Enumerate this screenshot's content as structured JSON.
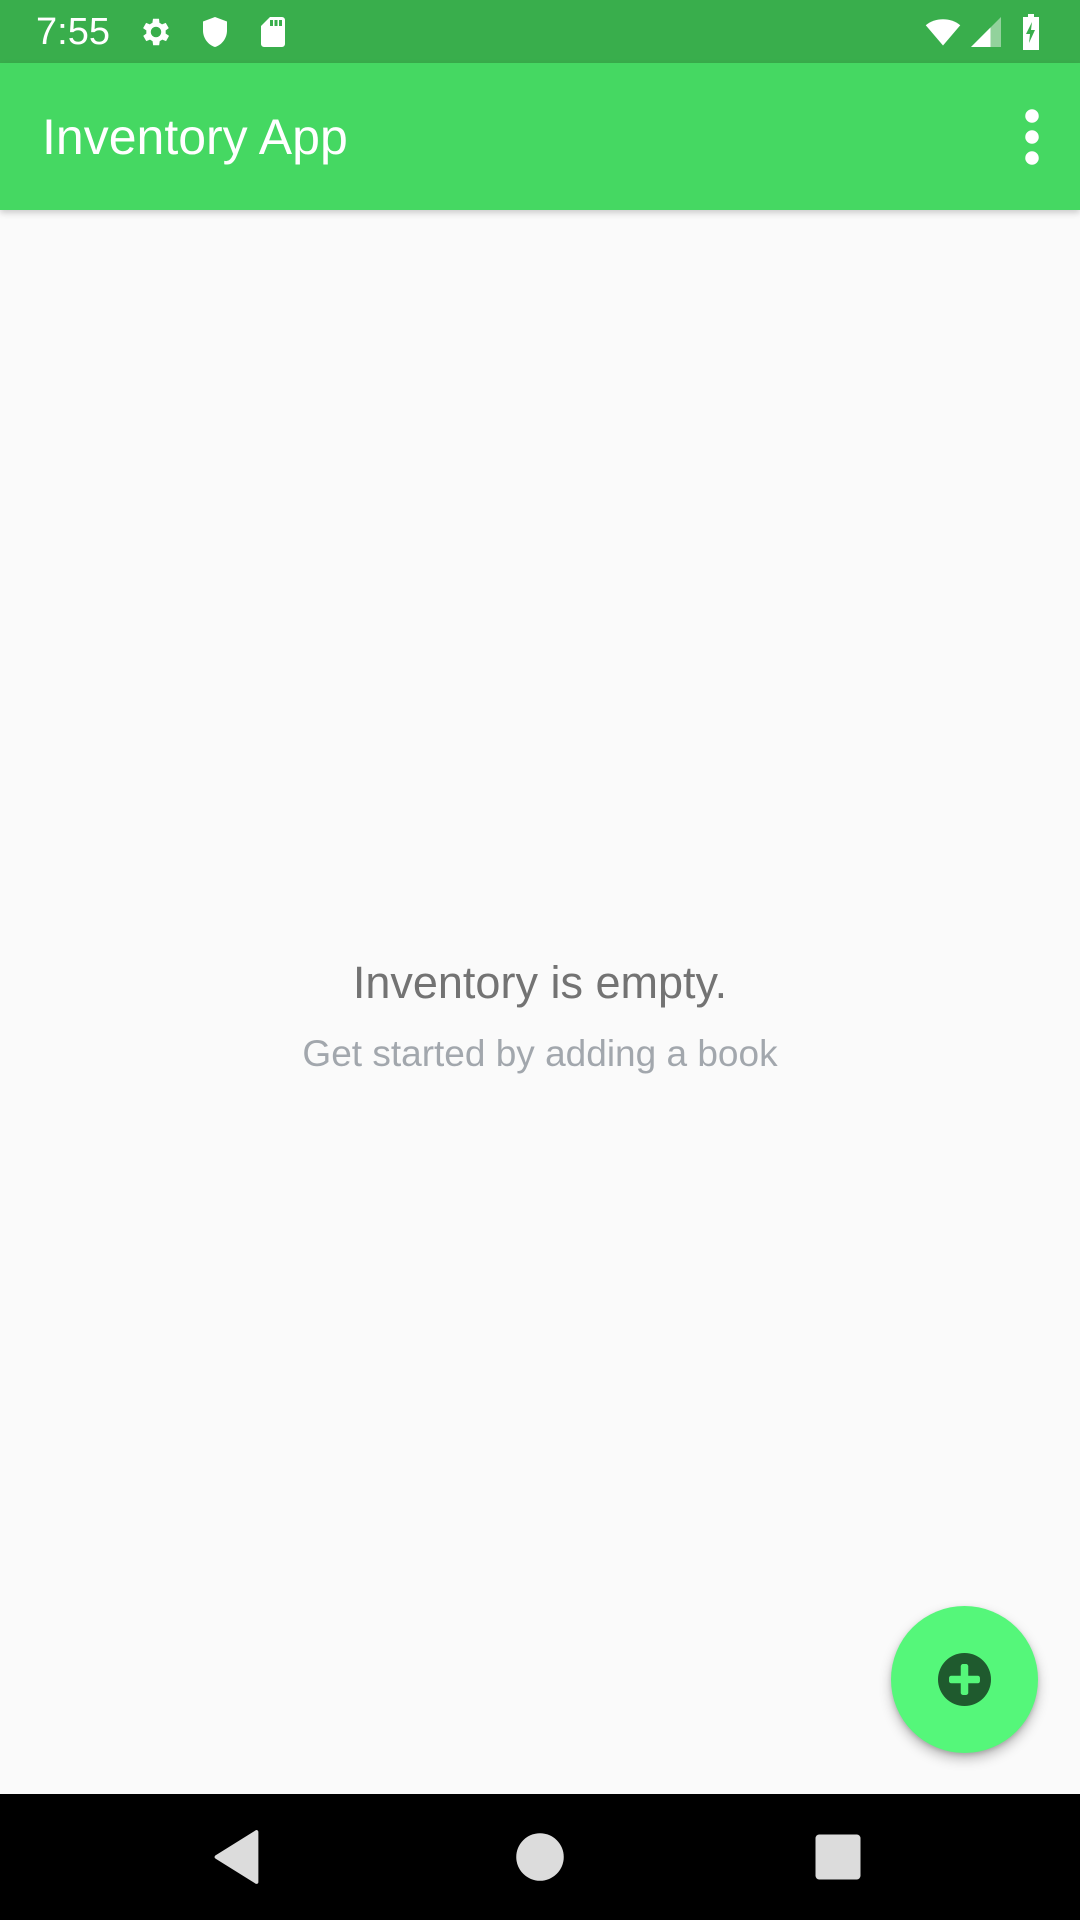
{
  "status_bar": {
    "time": "7:55",
    "icons_left": [
      "settings-icon",
      "shield-icon",
      "sd-card-icon"
    ],
    "icons_right": [
      "wifi-icon",
      "signal-icon",
      "battery-charging-icon"
    ]
  },
  "app_bar": {
    "title": "Inventory App",
    "overflow_icon": "more-vert-icon"
  },
  "empty_state": {
    "title": "Inventory is empty.",
    "subtitle": "Get started by adding a book"
  },
  "fab": {
    "icon": "add-circle-icon"
  },
  "nav_bar": {
    "buttons": [
      "back-icon",
      "home-icon",
      "recents-icon"
    ]
  },
  "colors": {
    "status_bar": "#39ae4c",
    "app_bar": "#45d862",
    "fab": "#55f77a",
    "fab_icon": "#1f5a2e",
    "background": "#fafafa"
  }
}
